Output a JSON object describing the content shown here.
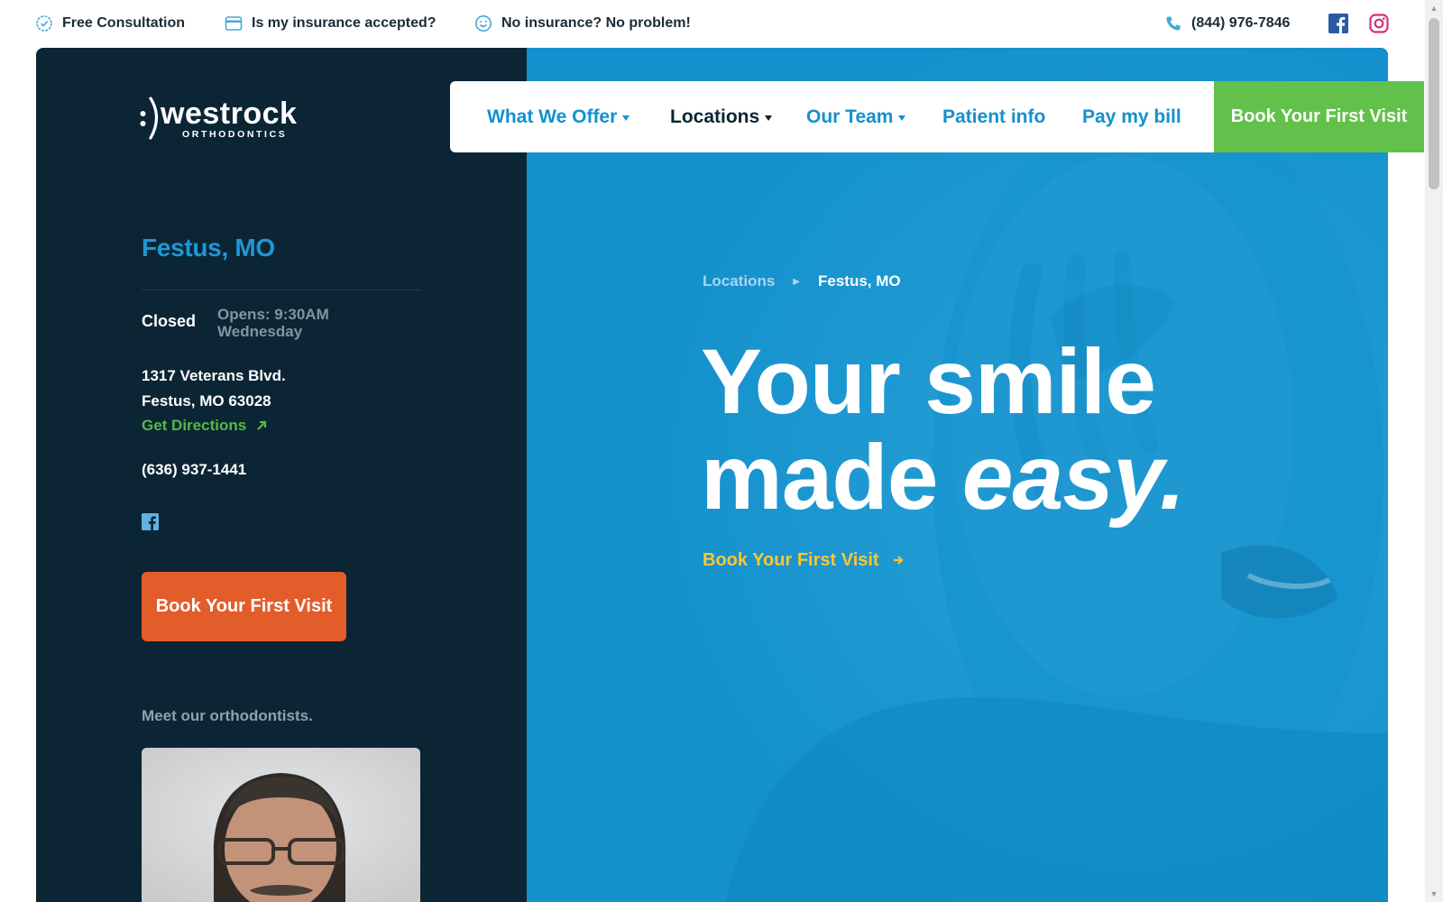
{
  "topbar": {
    "consultation": "Free Consultation",
    "insurance": "Is my insurance accepted?",
    "no_insurance": "No insurance? No problem!",
    "phone": "(844) 976-7846"
  },
  "brand": {
    "name": "westrock",
    "sub": "ORTHODONTICS"
  },
  "nav": {
    "items": [
      {
        "label": "What We Offer"
      },
      {
        "label": "Locations"
      },
      {
        "label": "Our Team"
      },
      {
        "label": "Patient info"
      },
      {
        "label": "Pay my bill"
      }
    ],
    "book": "Book Your First Visit"
  },
  "location": {
    "title": "Festus, MO",
    "status": "Closed",
    "opens_line1": "Opens: 9:30AM",
    "opens_line2": "Wednesday",
    "address_line1": "1317 Veterans Blvd.",
    "address_line2": "Festus, MO 63028",
    "directions": "Get Directions",
    "phone": "(636) 937-1441",
    "book": "Book Your First Visit",
    "meet": "Meet our orthodontists."
  },
  "hero": {
    "breadcrumb": [
      "Locations",
      "Festus, MO"
    ],
    "headline_line1": "Your smile",
    "headline_line2a": "made ",
    "headline_line2b": "easy.",
    "cta": "Book Your First Visit"
  },
  "colors": {
    "dark_panel": "#0c2535",
    "hero_blue": "#1491cc",
    "accent_blue": "#1f97d4",
    "green": "#62c14a",
    "orange": "#e35d2a",
    "yellow": "#ffc633"
  }
}
